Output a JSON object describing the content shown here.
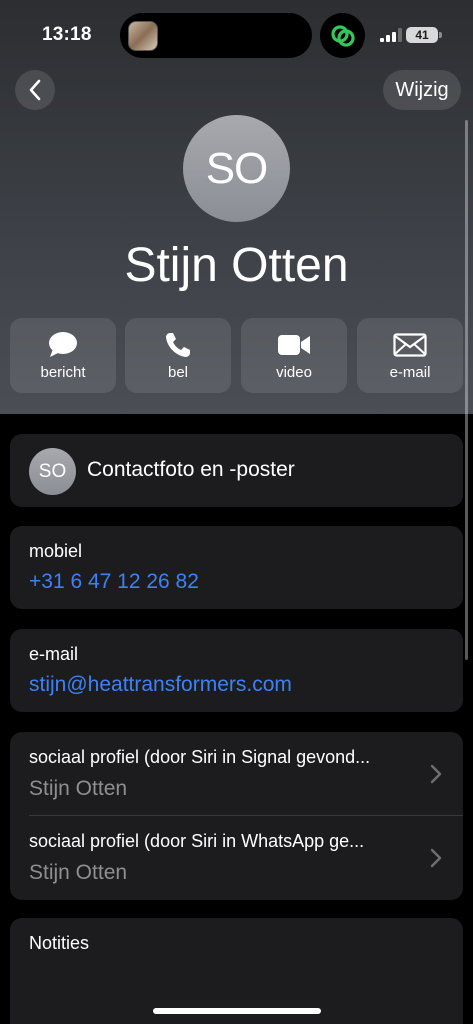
{
  "status_bar": {
    "time": "13:18",
    "battery": "41"
  },
  "nav": {
    "back_icon": "chevron-left-icon",
    "edit_label": "Wijzig"
  },
  "contact": {
    "initials": "SO",
    "name": "Stijn Otten"
  },
  "actions": [
    {
      "label": "bericht",
      "icon": "message-bubble-icon"
    },
    {
      "label": "bel",
      "icon": "phone-icon"
    },
    {
      "label": "video",
      "icon": "video-camera-icon"
    },
    {
      "label": "e-mail",
      "icon": "envelope-icon"
    }
  ],
  "poster": {
    "initials": "SO",
    "label": "Contactfoto en -poster"
  },
  "phone": {
    "label": "mobiel",
    "value": "+31 6 47 12 26 82"
  },
  "email": {
    "label": "e-mail",
    "value": "stijn@heattransformers.com"
  },
  "social_profiles": [
    {
      "title": "sociaal profiel (door Siri in Signal gevond...",
      "subtitle": "Stijn Otten"
    },
    {
      "title": "sociaal profiel (door Siri in WhatsApp ge...",
      "subtitle": "Stijn Otten"
    }
  ],
  "notes": {
    "label": "Notities"
  },
  "colors": {
    "accent": "#3b82f6",
    "card_bg": "#1c1c1e",
    "secondary_text": "#8e8e93"
  }
}
